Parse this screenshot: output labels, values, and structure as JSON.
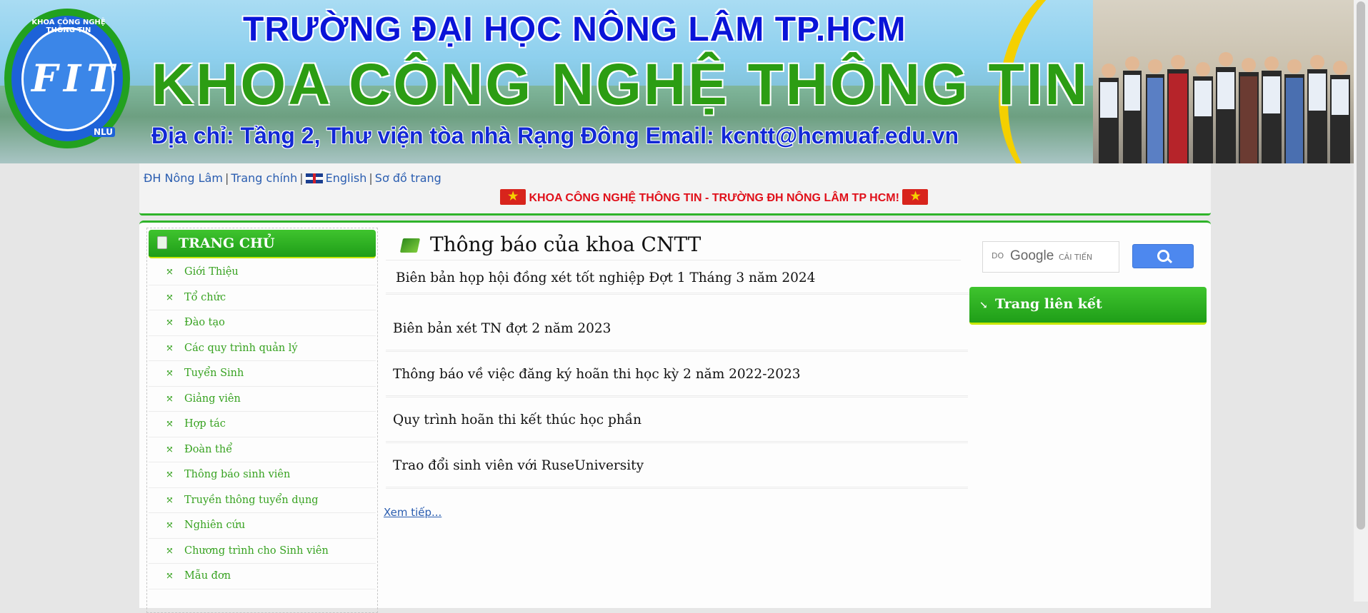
{
  "banner": {
    "line1": "TRƯỜNG ĐẠI HỌC NÔNG LÂM TP.HCM",
    "line2": "KHOA CÔNG NGHỆ THÔNG TIN",
    "line3": "Địa chỉ: Tầng 2, Thư viện tòa nhà Rạng Đông  Email: kcntt@hcmuaf.edu.vn",
    "logo_text": "FIT",
    "logo_arc": "KHOA CÔNG NGHỆ THÔNG TIN",
    "logo_sub": "NLU"
  },
  "toplinks": [
    "ĐH Nông Lâm",
    "Trang chính",
    "English",
    "Sơ đồ trang"
  ],
  "marquee": "KHOA CÔNG NGHỆ THÔNG TIN - TRƯỜNG ĐH NÔNG LÂM TP HCM!",
  "sidebar": {
    "title": "TRANG CHỦ",
    "items": [
      "Giới Thiệu",
      "Tổ chức",
      "Đào tạo",
      "Các quy trình quản lý",
      "Tuyển Sinh",
      "Giảng viên",
      "Hợp tác",
      "Đoàn thể",
      "Thông báo sinh viên",
      "Truyền thông tuyển dụng",
      "Nghiên cứu",
      "Chương trình cho Sinh viên",
      "Mẫu đơn"
    ]
  },
  "content": {
    "title": "Thông báo của khoa CNTT",
    "news": [
      "Biên bản họp hội đồng xét tốt nghiệp Đợt 1 Tháng 3 năm 2024",
      "Biên bản xét TN đợt 2 năm 2023",
      "Thông báo về việc đăng ký hoãn thi học kỳ 2 năm 2022-2023",
      "Quy trình hoãn thi kết thúc học phần",
      "Trao đổi sinh viên với RuseUniversity"
    ],
    "more": "Xem tiếp..."
  },
  "search": {
    "brand": "DO",
    "google": "Google",
    "enhanced": "CẢI TIẾN"
  },
  "right": {
    "links_title": "Trang liên kết"
  }
}
